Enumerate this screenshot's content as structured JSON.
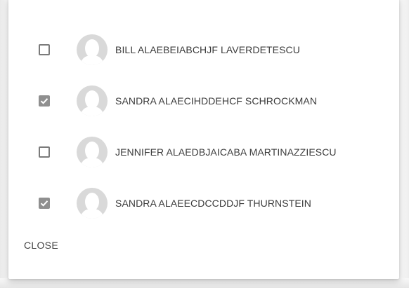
{
  "dialog": {
    "people": [
      {
        "name": "BILL ALAEBEIABCHJF LAVERDETESCU",
        "checked": false
      },
      {
        "name": "SANDRA ALAECIHDDEHCF SCHROCKMAN",
        "checked": true
      },
      {
        "name": "JENNIFER ALAEDBJAICABA MARTINAZZIESCU",
        "checked": false
      },
      {
        "name": "SANDRA ALAEECDCCDDJF THURNSTEIN",
        "checked": true
      }
    ],
    "close_label": "CLOSE"
  },
  "colors": {
    "checkbox_checked": "#8f8f8f",
    "checkbox_border": "#7b7b7b",
    "avatar_bg": "#d9d9d9",
    "avatar_fg": "#ffffff",
    "text": "#3b3b3b"
  },
  "icons": {
    "checkbox_checked": "check-icon",
    "avatar": "person-placeholder-icon"
  }
}
